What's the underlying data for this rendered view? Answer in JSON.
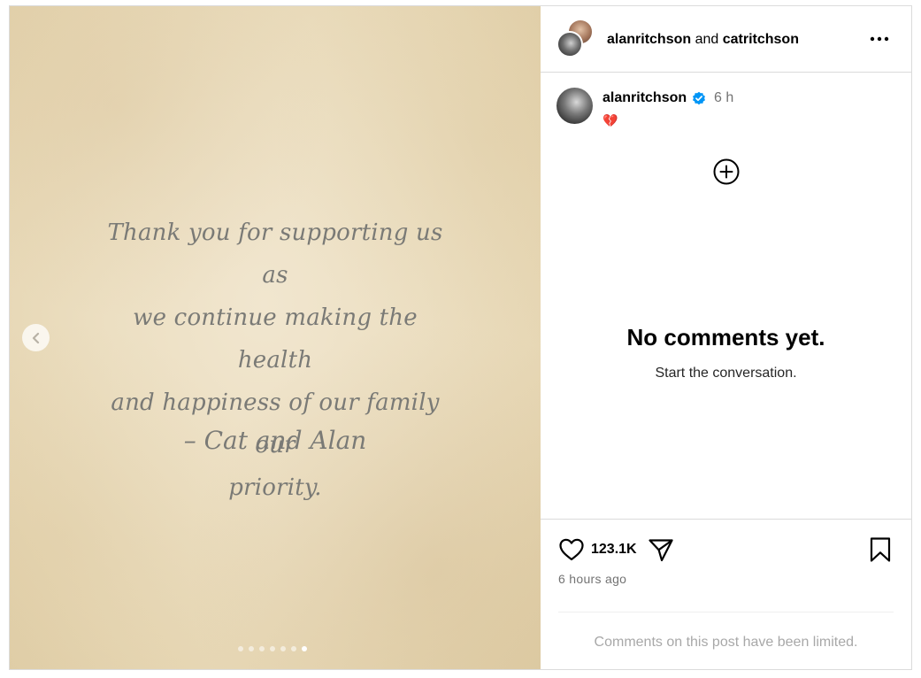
{
  "media": {
    "quote_lines": [
      "Thank you for supporting us as",
      "we continue making the health",
      "and happiness of our family our",
      "priority."
    ],
    "signature": "– Cat and Alan",
    "carousel_total": 7,
    "carousel_active_index": 7,
    "prev_icon": "chevron-left-icon"
  },
  "header": {
    "user1": "alanritchson",
    "conjunction": " and ",
    "user2": "catritchson",
    "more_icon": "more-horizontal-icon"
  },
  "caption": {
    "username": "alanritchson",
    "verified_icon": "verified-badge-icon",
    "time": "6 h",
    "text": "💔"
  },
  "comments": {
    "add_icon": "plus-circle-icon",
    "empty_title": "No comments yet.",
    "empty_subtitle": "Start the conversation."
  },
  "actions": {
    "like_icon": "heart-icon",
    "like_count": "123.1K",
    "share_icon": "send-icon",
    "save_icon": "bookmark-icon",
    "timestamp": "6 hours ago"
  },
  "footer": {
    "limited_text": "Comments on this post have been limited."
  },
  "colors": {
    "verified_blue": "#0095f6",
    "secondary_text": "#737373",
    "muted_text": "#a8a8a8",
    "border": "#dbdbdb",
    "quote_text": "#7a7a76"
  }
}
